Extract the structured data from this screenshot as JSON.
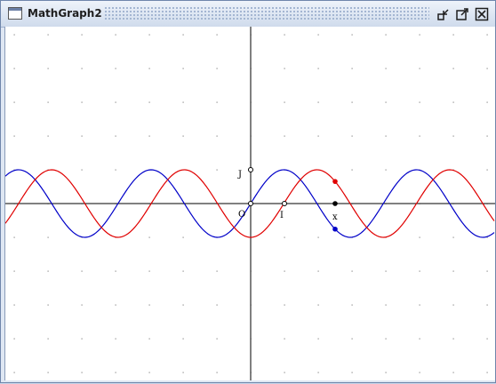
{
  "window": {
    "title": "MathGraph2"
  },
  "controls": {
    "minimize": "minimize-icon",
    "maximize": "maximize-icon",
    "close": "close-icon"
  },
  "graph": {
    "grid": "on",
    "labels": {
      "origin": "O",
      "unit_x": "I",
      "unit_y": "J",
      "x_point": "x"
    },
    "curves": [
      {
        "color": "#0000c8",
        "function": "sin(x)"
      },
      {
        "color": "#e00000",
        "function": "-cos(x)"
      }
    ],
    "colors": {
      "blue_curve": "#0000c8",
      "red_curve": "#e00000",
      "axes": "#000000",
      "grid": "#8a8a8a"
    }
  }
}
